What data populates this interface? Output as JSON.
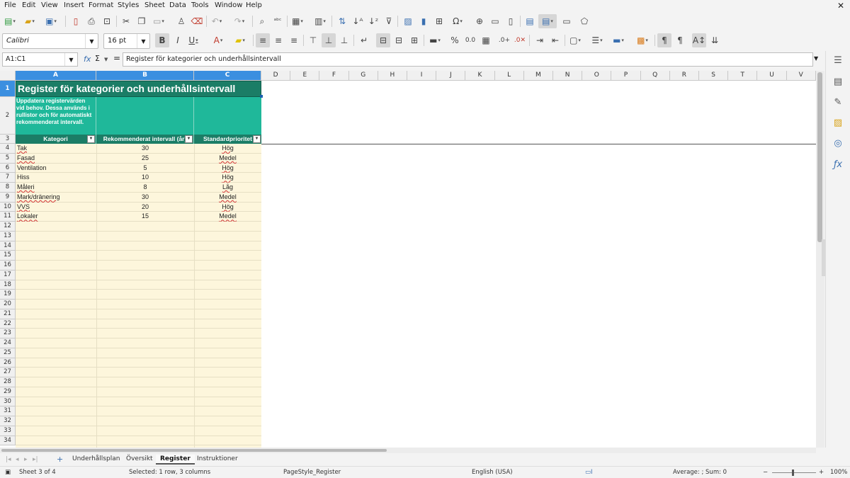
{
  "menu": [
    "File",
    "Edit",
    "View",
    "Insert",
    "Format",
    "Styles",
    "Sheet",
    "Data",
    "Tools",
    "Window",
    "Help"
  ],
  "toolbar": {
    "font_name": "Calibri",
    "font_size": "16 pt"
  },
  "formula_bar": {
    "name_box": "A1:C1",
    "fx": "fx",
    "sum": "Σ",
    "equals": "=",
    "content": "Register för kategorier och underhållsintervall"
  },
  "columns": [
    "A",
    "B",
    "C",
    "D",
    "E",
    "F",
    "G",
    "H",
    "I",
    "J",
    "K",
    "L",
    "M",
    "N",
    "O",
    "P",
    "Q",
    "R",
    "S",
    "T",
    "U",
    "V"
  ],
  "rows": [
    "1",
    "2",
    "3",
    "4",
    "5",
    "6",
    "7",
    "8",
    "9",
    "10",
    "11",
    "12",
    "13",
    "14",
    "15",
    "16",
    "17",
    "18",
    "19",
    "20",
    "21",
    "22",
    "23",
    "24",
    "25",
    "26",
    "27",
    "28",
    "29",
    "30",
    "31",
    "32",
    "33",
    "34"
  ],
  "sheet": {
    "title": "Register för kategorier och underhållsintervall",
    "description": "Uppdatera registervärden vid behov. Dessa används i rullistor och för automatiskt rekommenderat intervall.",
    "headers": [
      "Kategori",
      "Rekommenderat intervall (år)",
      "Standardprioritet"
    ],
    "rows": [
      [
        "Tak",
        "30",
        "Hög"
      ],
      [
        "Fasad",
        "25",
        "Medel"
      ],
      [
        "Ventilation",
        "5",
        "Hög"
      ],
      [
        "Hiss",
        "10",
        "Hög"
      ],
      [
        "Måleri",
        "8",
        "Låg"
      ],
      [
        "Mark/dränering",
        "30",
        "Medel"
      ],
      [
        "VVS",
        "20",
        "Hög"
      ],
      [
        "Lokaler",
        "15",
        "Medel"
      ]
    ]
  },
  "tabs": {
    "items": [
      "Underhållsplan",
      "Översikt",
      "Register",
      "Instruktioner"
    ],
    "active": "Register"
  },
  "status": {
    "sheet": "Sheet 3 of 4",
    "selection": "Selected: 1 row, 3 columns",
    "page_style": "PageStyle_Register",
    "language": "English (USA)",
    "summary": "Average: ; Sum: 0",
    "zoom": "100%"
  },
  "colors": {
    "header_dark": "#1b7d66",
    "header_light": "#1fb89a",
    "data_fill": "#fdf6dc",
    "selection": "#3b8fe0"
  }
}
